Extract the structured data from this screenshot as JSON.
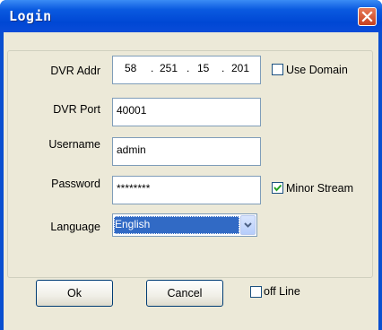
{
  "window": {
    "title": "Login"
  },
  "form": {
    "dvr_addr_label": "DVR Addr",
    "dvr_addr": {
      "o1": "58",
      "o2": "251",
      "o3": "15",
      "o4": "201",
      "dot": "."
    },
    "dvr_port_label": "DVR Port",
    "dvr_port_value": "40001",
    "username_label": "Username",
    "username_value": "admin",
    "password_label": "Password",
    "password_value": "********",
    "language_label": "Language",
    "language_value": "English"
  },
  "options": {
    "use_domain": {
      "label": "Use Domain",
      "checked": false
    },
    "minor_stream": {
      "label": "Minor Stream",
      "checked": true
    },
    "off_line": {
      "label": "off Line",
      "checked": false
    }
  },
  "buttons": {
    "ok": "Ok",
    "cancel": "Cancel"
  }
}
